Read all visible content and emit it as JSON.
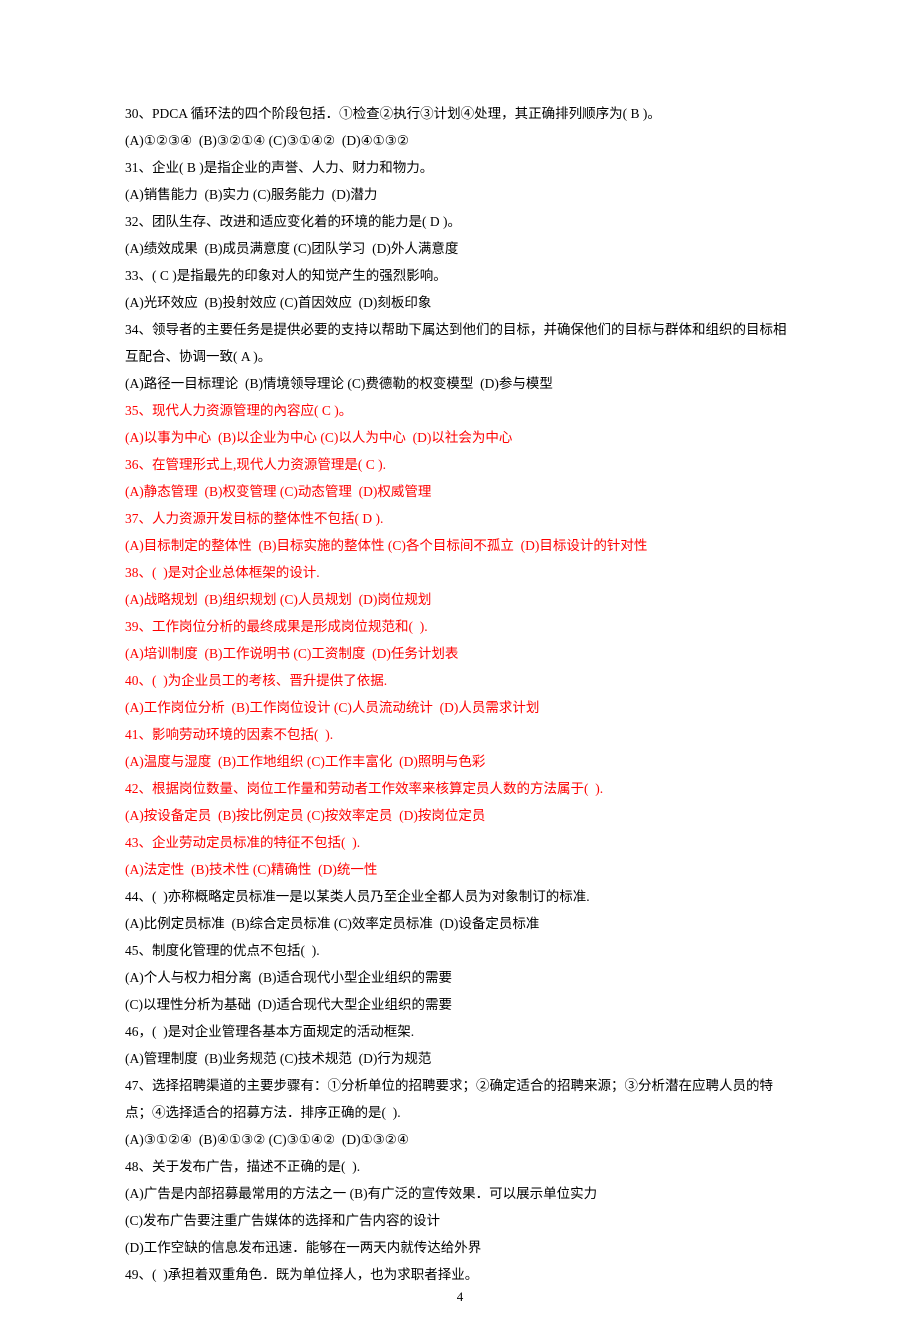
{
  "page_number": "4",
  "lines": [
    {
      "text": "30、PDCA 循环法的四个阶段包括．①检查②执行③计划④处理，其正确排列顺序为( B )。",
      "red": false
    },
    {
      "text": "(A)①②③④  (B)③②①④ (C)③①④②  (D)④①③②",
      "red": false
    },
    {
      "text": "31、企业( B )是指企业的声誉、人力、财力和物力。",
      "red": false
    },
    {
      "text": "(A)销售能力  (B)实力 (C)服务能力  (D)潜力",
      "red": false
    },
    {
      "text": "32、团队生存、改进和适应变化着的环境的能力是( D )。",
      "red": false
    },
    {
      "text": "(A)绩效成果  (B)成员满意度 (C)团队学习  (D)外人满意度",
      "red": false
    },
    {
      "text": "33、( C )是指最先的印象对人的知觉产生的强烈影响。",
      "red": false
    },
    {
      "text": "(A)光环效应  (B)投射效应 (C)首因效应  (D)刻板印象",
      "red": false
    },
    {
      "text": "34、领导者的主要任务是提供必要的支持以帮助下属达到他们的目标，并确保他们的目标与群体和组织的目标相互配合、协调一致( A )。",
      "red": false
    },
    {
      "text": "(A)路径一目标理论  (B)情境领导理论 (C)费德勒的权变模型  (D)参与模型",
      "red": false
    },
    {
      "text": "35、现代人力资源管理的內容应( C )。",
      "red": true
    },
    {
      "text": "(A)以事为中心  (B)以企业为中心 (C)以人为中心  (D)以社会为中心",
      "red": true
    },
    {
      "text": "36、在管理形式上,现代人力资源管理是( C ).",
      "red": true
    },
    {
      "text": "(A)静态管理  (B)权变管理 (C)动态管理  (D)权威管理",
      "red": true
    },
    {
      "text": "37、人力资源开发目标的整体性不包括( D ).",
      "red": true
    },
    {
      "text": "(A)目标制定的整体性  (B)目标实施的整体性 (C)各个目标间不孤立  (D)目标设计的针对性",
      "red": true
    },
    {
      "text": "38、(  )是对企业总体框架的设计.",
      "red": true
    },
    {
      "text": "(A)战略规划  (B)组织规划 (C)人员规划  (D)岗位规划",
      "red": true
    },
    {
      "text": "39、工作岗位分析的最终成果是形成岗位规范和(  ).",
      "red": true
    },
    {
      "text": "(A)培训制度  (B)工作说明书 (C)工资制度  (D)任务计划表",
      "red": true
    },
    {
      "text": "40、(  )为企业员工的考核、晋升提供了依据.",
      "red": true
    },
    {
      "text": "(A)工作岗位分析  (B)工作岗位设计 (C)人员流动统计  (D)人员需求计划",
      "red": true
    },
    {
      "text": "41、影响劳动环境的因素不包括(  ).",
      "red": true
    },
    {
      "text": "(A)温度与湿度  (B)工作地组织 (C)工作丰富化  (D)照明与色彩",
      "red": true
    },
    {
      "text": "42、根据岗位数量、岗位工作量和劳动者工作效率来核算定员人数的方法属于(  ).",
      "red": true
    },
    {
      "text": "(A)按设备定员  (B)按比例定员 (C)按效率定员  (D)按岗位定员",
      "red": true
    },
    {
      "text": "43、企业劳动定员标准的特征不包括(  ).",
      "red": true
    },
    {
      "text": "(A)法定性  (B)技术性 (C)精确性  (D)统一性",
      "red": true
    },
    {
      "text": "44、(  )亦称概略定员标准一是以某类人员乃至企业全都人员为对象制订的标准.",
      "red": false
    },
    {
      "text": "(A)比例定员标准  (B)综合定员标准 (C)效率定员标准  (D)设备定员标准",
      "red": false
    },
    {
      "text": "45、制度化管理的优点不包括(  ).",
      "red": false
    },
    {
      "text": "(A)个人与权力相分离  (B)适合现代小型企业组织的需要",
      "red": false
    },
    {
      "text": "(C)以理性分析为基础  (D)适合现代大型企业组织的需要",
      "red": false
    },
    {
      "text": "46，(  )是对企业管理各基本方面规定的活动框架.",
      "red": false
    },
    {
      "text": "(A)管理制度  (B)业务规范 (C)技术规范  (D)行为规范",
      "red": false
    },
    {
      "text": "47、选择招聘渠道的主要步骤有：①分析单位的招聘要求；②确定适合的招聘来源；③分析潜在应聘人员的特点；④选择适合的招募方法．排序正确的是(  ).",
      "red": false
    },
    {
      "text": "(A)③①②④  (B)④①③② (C)③①④②  (D)①③②④",
      "red": false
    },
    {
      "text": "48、关于发布广告，描述不正确的是(  ).",
      "red": false
    },
    {
      "text": "(A)广告是内部招募最常用的方法之一 (B)有广泛的宣传效果．可以展示单位实力",
      "red": false
    },
    {
      "text": "(C)发布广告要注重广告媒体的选择和广告内容的设计",
      "red": false
    },
    {
      "text": "(D)工作空缺的信息发布迅速．能够在一两天内就传达给外界",
      "red": false
    },
    {
      "text": "49、(  )承担着双重角色．既为单位择人，也为求职者择业。",
      "red": false
    }
  ]
}
